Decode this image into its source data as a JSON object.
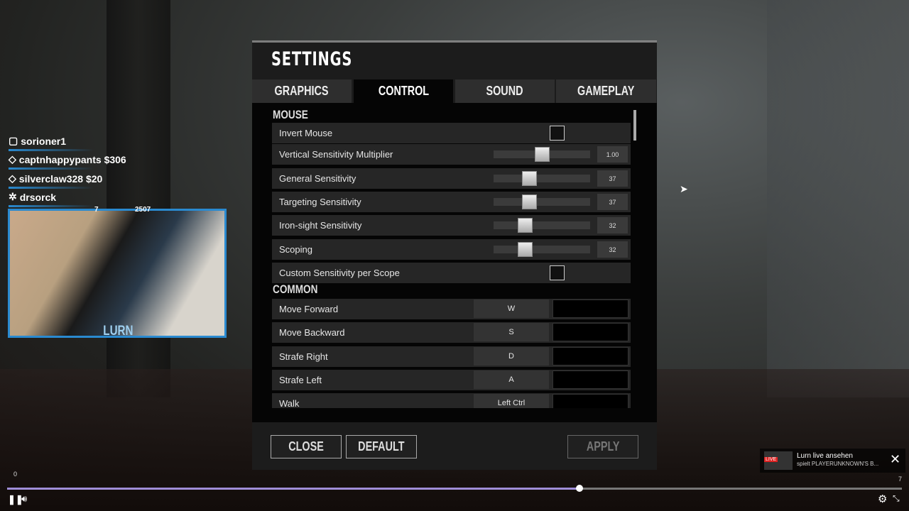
{
  "settings": {
    "title": "SETTINGS",
    "tabs": [
      {
        "label": "GRAPHICS"
      },
      {
        "label": "CONTROL",
        "active": true
      },
      {
        "label": "SOUND"
      },
      {
        "label": "GAMEPLAY"
      }
    ],
    "sections": {
      "mouse": "MOUSE",
      "common": "COMMON"
    },
    "mouse": [
      {
        "label": "Invert Mouse",
        "type": "checkbox",
        "checked": false
      },
      {
        "label": "Vertical Sensitivity Multiplier",
        "type": "slider",
        "value": "1.00",
        "fraction": 0.5
      },
      {
        "label": "General Sensitivity",
        "type": "slider",
        "value": "37",
        "fraction": 0.37
      },
      {
        "label": "Targeting Sensitivity",
        "type": "slider",
        "value": "37",
        "fraction": 0.37
      },
      {
        "label": "Iron-sight Sensitivity",
        "type": "slider",
        "value": "32",
        "fraction": 0.32
      },
      {
        "label": "Scoping",
        "type": "slider",
        "value": "32",
        "fraction": 0.32
      },
      {
        "label": "Custom Sensitivity per Scope",
        "type": "checkbox",
        "checked": false
      }
    ],
    "common": [
      {
        "label": "Move Forward",
        "key": "W"
      },
      {
        "label": "Move Backward",
        "key": "S"
      },
      {
        "label": "Strafe Right",
        "key": "D"
      },
      {
        "label": "Strafe Left",
        "key": "A"
      },
      {
        "label": "Walk",
        "key": "Left Ctrl"
      }
    ],
    "buttons": {
      "close": "CLOSE",
      "default": "DEFAULT",
      "apply": "APPLY"
    }
  },
  "overlay": {
    "chat": [
      {
        "icon": "twitch-icon",
        "text": "sorioner1"
      },
      {
        "icon": "diamond-icon",
        "text": "captnhappypants $306"
      },
      {
        "icon": "diamond-icon",
        "text": "silverclaw328 $20"
      },
      {
        "icon": "star-icon",
        "text": "drsorck"
      }
    ],
    "cam_left": "7",
    "cam_right": "2507",
    "cam_name": "LURN"
  },
  "player": {
    "time_left": "0",
    "time_right": "7",
    "progress": 0.64,
    "accent": "#a08ed8",
    "notification": {
      "badge": "LIVE",
      "title": "Lurn live ansehen",
      "subtitle": "spielt PLAYERUNKNOWN'S B..."
    }
  }
}
